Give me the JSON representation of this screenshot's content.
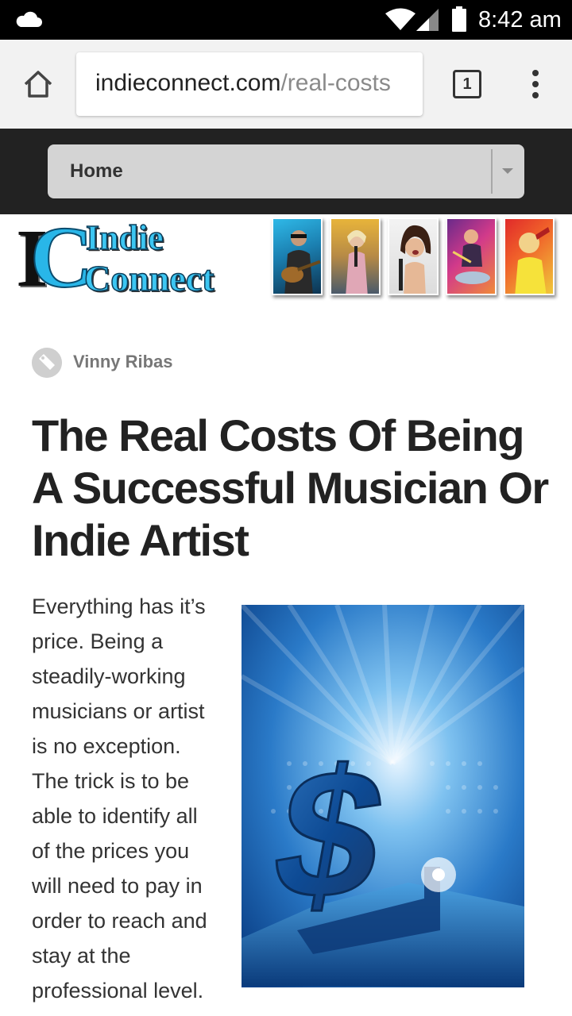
{
  "status_bar": {
    "time": "8:42 am",
    "icons": [
      "cloud-icon",
      "wifi-icon",
      "signal-icon",
      "battery-icon"
    ]
  },
  "browser": {
    "url_host": "indieconnect.com",
    "url_path": "/real-costs",
    "tab_count": "1",
    "icons": [
      "home-icon",
      "tabs-icon",
      "overflow-menu-icon"
    ]
  },
  "nav": {
    "selected": "Home"
  },
  "logo": {
    "initials_i": "I",
    "initials_c": "C",
    "word1": "Indie",
    "word2": "Connect"
  },
  "article": {
    "author": "Vinny Ribas",
    "title": "The Real Costs Of Being A Successful Musician Or Indie Artist",
    "body_lines": [
      "Everything has it’s",
      "price. Being a",
      "steadily-working",
      "musicians or artist",
      "is no exception.",
      "The trick is to be",
      "able to identify all",
      "of the prices you",
      "will need to pay in",
      "order to reach and",
      "stay at the",
      "professional level."
    ]
  },
  "colors": {
    "status_bar": "#000000",
    "toolbar": "#f2f2f2",
    "nav_bar": "#222222",
    "logo_cyan": "#29b6e8",
    "hero_blue": "#1a5fb0"
  }
}
